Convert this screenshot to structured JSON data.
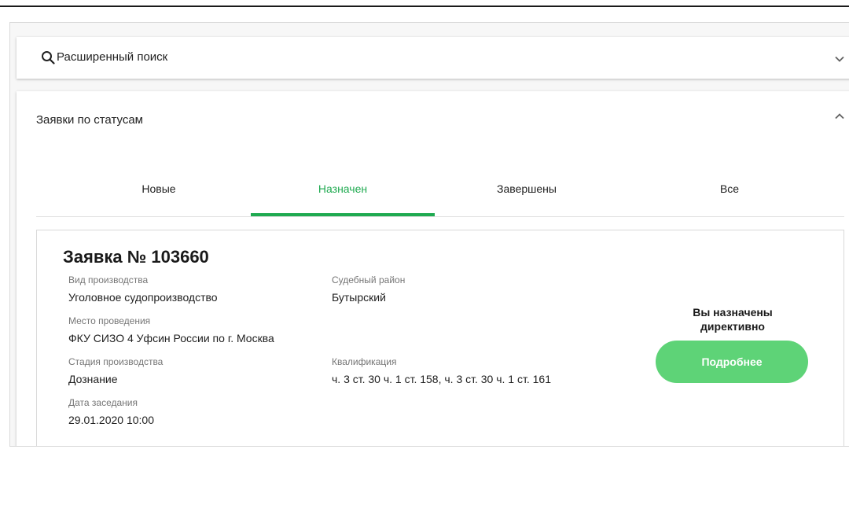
{
  "search": {
    "label": "Расширенный поиск",
    "icon": "search-icon",
    "state_icon": "chevron-down-icon"
  },
  "status_panel": {
    "title": "Заявки по статусам",
    "state_icon": "chevron-up-icon",
    "tabs": [
      {
        "label": "Новые",
        "active": false
      },
      {
        "label": "Назначен",
        "active": true
      },
      {
        "label": "Завершены",
        "active": false
      },
      {
        "label": "Все",
        "active": false
      }
    ]
  },
  "request": {
    "title": "Заявка № 103660",
    "fields": {
      "proceeding_type": {
        "label": "Вид производства",
        "value": "Уголовное судопроизводство"
      },
      "court_district": {
        "label": "Судебный район",
        "value": "Бутырский"
      },
      "venue": {
        "label": "Место проведения",
        "value": "ФКУ СИЗО 4 Уфсин России по г. Москва"
      },
      "stage": {
        "label": "Стадия производства",
        "value": "Дознание"
      },
      "qualification": {
        "label": "Квалификация",
        "value": "ч. 3 ст. 30 ч. 1 ст. 158, ч. 3 ст. 30 ч. 1 ст. 161"
      },
      "session_date": {
        "label": "Дата заседания",
        "value": "29.01.2020 10:00"
      }
    },
    "assignment_note": "Вы назначены директивно",
    "details_button": "Подробнее"
  },
  "colors": {
    "accent": "#1faa50",
    "button": "#5ed377",
    "text": "#212121",
    "muted": "#757575"
  }
}
